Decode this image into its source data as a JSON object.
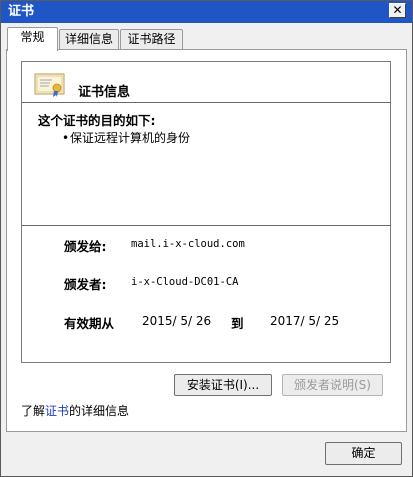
{
  "window": {
    "title": "证书",
    "close_label": "✕"
  },
  "tabs": [
    {
      "label": "常规",
      "active": true
    },
    {
      "label": "详细信息",
      "active": false
    },
    {
      "label": "证书路径",
      "active": false
    }
  ],
  "cert_info": {
    "icon": "certificate-icon",
    "title": "证书信息",
    "purpose_heading": "这个证书的目的如下:",
    "purposes": [
      "保证远程计算机的身份"
    ],
    "issued_to_label": "颁发给:",
    "issued_to_value": "mail.i-x-cloud.com",
    "issued_by_label": "颁发者:",
    "issued_by_value": "i-x-Cloud-DC01-CA",
    "validity_label": "有效期从",
    "valid_from": "2015/  5/  26",
    "to_label": "到",
    "valid_to": "2017/  5/  25"
  },
  "buttons": {
    "install": "安装证书(I)...",
    "issuer_statement": "颁发者说明(S)",
    "ok": "确定"
  },
  "learn_more": {
    "prefix": "了解",
    "link": "证书",
    "suffix": "的详细信息"
  },
  "colors": {
    "titlebar": "#1f55c4",
    "link": "#1c3fbf"
  }
}
